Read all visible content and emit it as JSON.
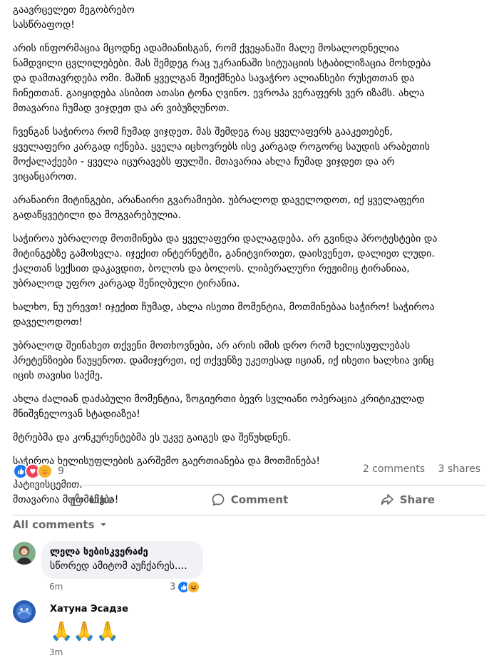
{
  "post": {
    "paragraphs": [
      [
        "გაავრცელეთ მეგობრებო",
        "სასწრაფოდ!"
      ],
      [
        "არის ინფორმაცია მცოდნე ადამიანისგან, რომ ქვეყანაში მალე მოსალოდნელია",
        "ნამდვილი ცვლილებები. მას შემდეგ რაც უკრაინაში სიტუაციის სტაბილიზაცია მოხდება",
        "და დამთავრდება ომი. მაშინ ყველგან შეიქმნება სავაჭრო ალიანსები რუსეთთან და",
        "ჩინეთთან. გაიყიდება ასიბით ათასი ტონა ღვინო. ევროპა ვერაფერს ვერ იზამს. ახლა",
        "მთავარია ჩუმად ვიჯდეთ და არ ვიბუზღუნოთ."
      ],
      [
        "ჩვენგან საჭიროა რომ ჩუმად ვიჯდეთ. მას შემდეგ რაც ყველაფერს გააკეთებენ,",
        "ყველაფერი კარგად იქნება. ყველა იცხოვრებს ისე კარგად როგორც საუდის არაბეთის",
        "მოქალაქეები - ყველა იცურავებს ფულში. მთავარია ახლა ჩუმად ვიჯდეთ და არ",
        "ვიცანცაროთ."
      ],
      [
        "არანაირი მიტინგები, არანაირი გვარამიები. უბრალოდ დაველოდოთ, იქ ყველაფერი",
        "გადაწყვეტილი და მოგვარებულია."
      ],
      [
        "საჭიროა უბრალოდ მოთმინება და ყველაფერი დალაგდება. არ გვინდა პროტესტები და",
        "მიტინგებზე გამოსვლა. იჯექით ინტერნეტში, განიტვირთეთ, დაისვენეთ, დალიეთ ლუდი.",
        "ქალთან სექსით დაკავდით, ბოლოს და ბოლოს. ლიბერალური რეჟიმიც ტირანიაა,",
        "უბრალოდ უფრო კარგად შენიღბული ტირანია."
      ],
      [
        "ხალხო, ნუ ურევთ! იჯექით ჩუმად, ახლა ისეთი მომენტია, მოთმინებაა საჭირო! საჭიროა",
        "დაველოდოთ!"
      ],
      [
        "უბრალოდ შეინახეთ თქვენი მოთხოვნები, არ არის იმის დრო რომ ხელისუფლებას",
        "პრეტენზიები წაუყენოთ. დამიჯერეთ, იქ თქვენზე უკეთესად იციან, იქ ისეთი ხალხია ვინც",
        "იცის თავისი საქმე."
      ],
      [
        "ახლა ძალიან დაძაბული მომენტია, ზოგიერთი ბევრ სვლიანი ოპერაცია კრიტიკულად",
        "მნიშვნელოვან სტადიაზეა!"
      ],
      [
        "მტრებმა და კონკურენტებმა ეს უკვე გაიგეს და შეწუხდნენ."
      ],
      [
        "საჭიროა ხელისუფლების გარშემო გაერთიანება და მოთმინება!"
      ],
      [
        "პატივისცემით.",
        "მთავარია მოთმინება!"
      ]
    ]
  },
  "stats": {
    "reaction_count": "9",
    "comments": "2 comments",
    "shares": "3 shares"
  },
  "actions": {
    "like": "Like",
    "comment": "Comment",
    "share": "Share"
  },
  "comments_filter": "All comments",
  "comments": [
    {
      "author": "ლელა სებისკვერაძე",
      "text": "სწორედ ამიტომ აუჩქარეს....",
      "time": "6m",
      "reaction_count": "3"
    },
    {
      "author": "Хатуна Эсадзе",
      "text": "🙏🙏🙏",
      "time": "3m"
    }
  ],
  "colors": {
    "text": "#050505",
    "secondary": "#65676b",
    "like_blue": "#1877f2",
    "bubble": "#f0f2f5"
  }
}
